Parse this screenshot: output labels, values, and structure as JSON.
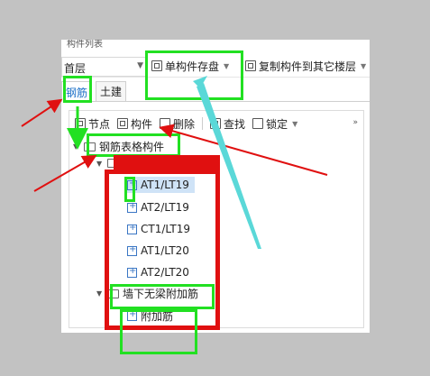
{
  "window": {
    "title_snippet": "构件列表"
  },
  "toolbar": {
    "floor": "首层",
    "single_save": "单构件存盘",
    "copy_to_floor": "复制构件到其它楼层"
  },
  "tabs": [
    {
      "label": "钢筋",
      "active": true
    },
    {
      "label": "土建",
      "active": false
    }
  ],
  "subtoolbar": {
    "node": "节点",
    "component": "构件",
    "delete": "删除",
    "find": "查找",
    "lock": "锁定",
    "more": "»"
  },
  "tree": {
    "root": "钢筋表格构件",
    "group1_items": [
      "AT1/LT19",
      "AT2/LT19",
      "CT1/LT19",
      "AT1/LT20",
      "AT2/LT20"
    ],
    "group2": "墙下无梁附加筋",
    "group2_items": [
      "附加筋"
    ]
  },
  "colors": {
    "annot_green": "#22e022",
    "annot_red": "#e01010",
    "annot_cyan": "#5ad8d8",
    "tab_active": "#1a6fc7"
  }
}
